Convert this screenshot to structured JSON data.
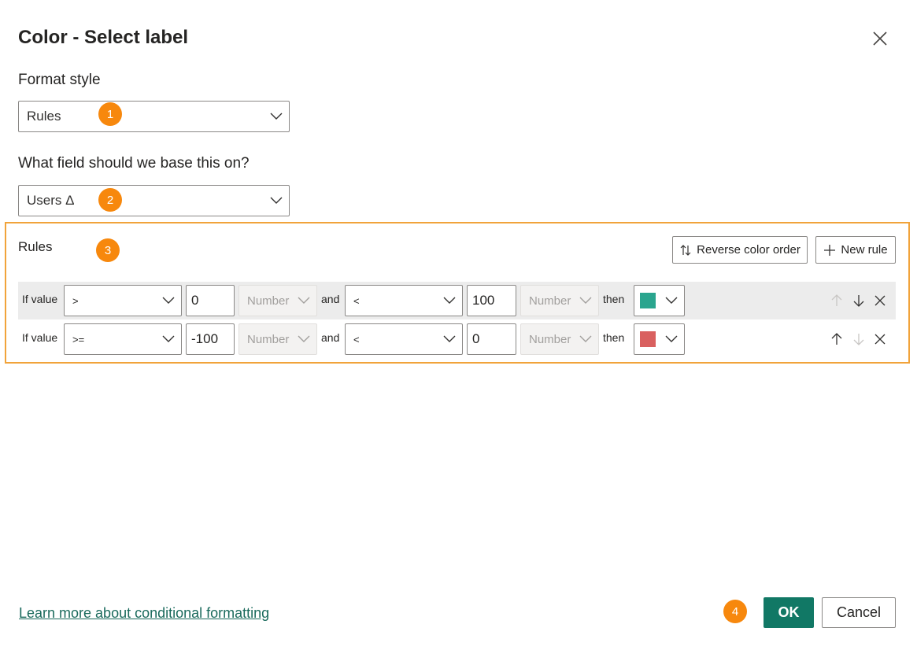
{
  "dialog": {
    "title": "Color - Select label"
  },
  "format_style": {
    "label": "Format style",
    "value": "Rules",
    "badge": "1"
  },
  "field": {
    "label": "What field should we base this on?",
    "value": "Users Δ",
    "badge": "2"
  },
  "rules": {
    "label": "Rules",
    "badge": "3",
    "reverse_label": "Reverse color order",
    "new_rule_label": "New rule",
    "rows": [
      {
        "if_label": "If value",
        "op1": ">",
        "val1": "0",
        "type1": "Number",
        "and_label": "and",
        "op2": "<",
        "val2": "100",
        "type2": "Number",
        "then_label": "then",
        "color": "#2aa58e"
      },
      {
        "if_label": "If value",
        "op1": ">=",
        "val1": "-100",
        "type1": "Number",
        "and_label": "and",
        "op2": "<",
        "val2": "0",
        "type2": "Number",
        "then_label": "then",
        "color": "#d9605f"
      }
    ]
  },
  "footer": {
    "learn_more": "Learn more about conditional formatting",
    "badge": "4",
    "ok_label": "OK",
    "cancel_label": "Cancel"
  },
  "colors": {
    "accent": "#117865",
    "badge": "#f7880d",
    "highlight_border": "#f1a33a"
  }
}
